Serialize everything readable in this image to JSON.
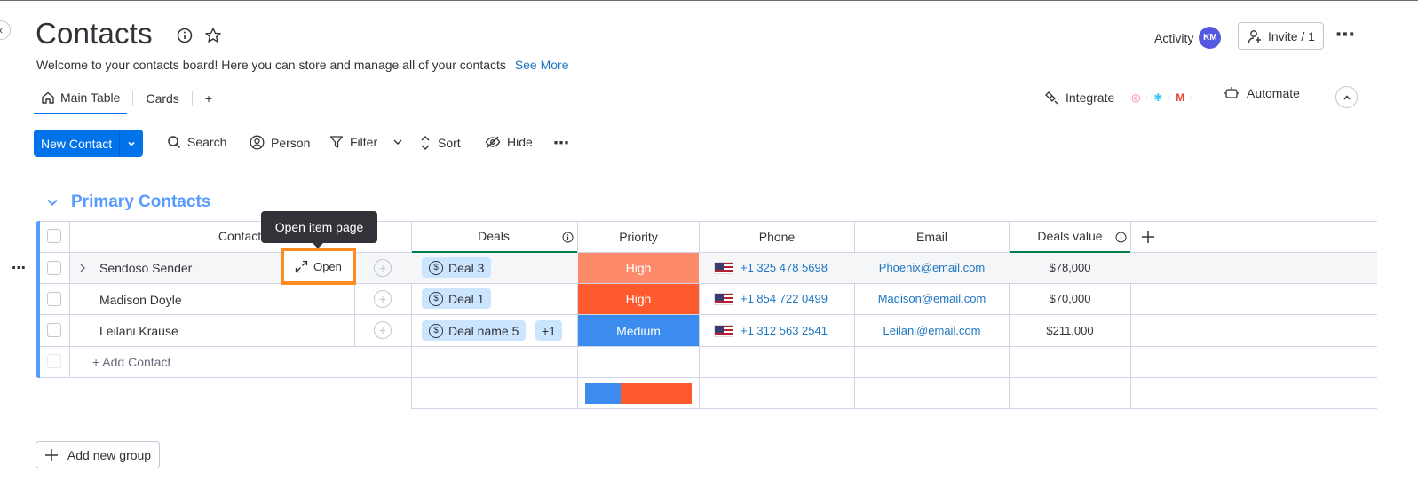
{
  "header": {
    "title": "Contacts",
    "subtitle": "Welcome to your contacts board! Here you can store and manage all of your contacts",
    "see_more": "See More",
    "activity_label": "Activity",
    "avatar_initials": "KM",
    "invite_label": "Invite / 1"
  },
  "tabs": {
    "main_table": "Main Table",
    "cards": "Cards",
    "add": "+",
    "integrate": "Integrate",
    "automate": "Automate"
  },
  "toolbar": {
    "new_contact": "New Contact",
    "search": "Search",
    "person": "Person",
    "filter": "Filter",
    "sort": "Sort",
    "hide": "Hide"
  },
  "group": {
    "title": "Primary Contacts",
    "color": "#579bfc"
  },
  "table": {
    "columns": {
      "contact": "Contact",
      "deals": "Deals",
      "priority": "Priority",
      "phone": "Phone",
      "email": "Email",
      "deals_value": "Deals value"
    },
    "rows": [
      {
        "name": "Sendoso Sender",
        "deal": "Deal 3",
        "priority": "High",
        "priority_color": "#fd8a6a",
        "phone": "+1 325 478 5698",
        "email": "Phoenix@email.com",
        "value": "$78,000"
      },
      {
        "name": "Madison Doyle",
        "deal": "Deal 1",
        "priority": "High",
        "priority_color": "#ff5a2e",
        "phone": "+1 854 722 0499",
        "email": "Madison@email.com",
        "value": "$70,000"
      },
      {
        "name": "Leilani Krause",
        "deal": "Deal name 5",
        "deal_extra": "+1",
        "priority": "Medium",
        "priority_color": "#3c8cf0",
        "phone": "+1 312 563 2541",
        "email": "Leilani@email.com",
        "value": "$211,000"
      }
    ],
    "add_contact": "+ Add Contact",
    "priority_summary": [
      {
        "label": "Medium",
        "color": "#3c8cf0",
        "fraction": 0.33
      },
      {
        "label": "High",
        "color": "#ff5a2e",
        "fraction": 0.67
      }
    ]
  },
  "tooltip": "Open item page",
  "open_button": "Open",
  "add_group": "Add new group",
  "colors": {
    "accent": "#0073ea",
    "link": "#1f76c2"
  }
}
